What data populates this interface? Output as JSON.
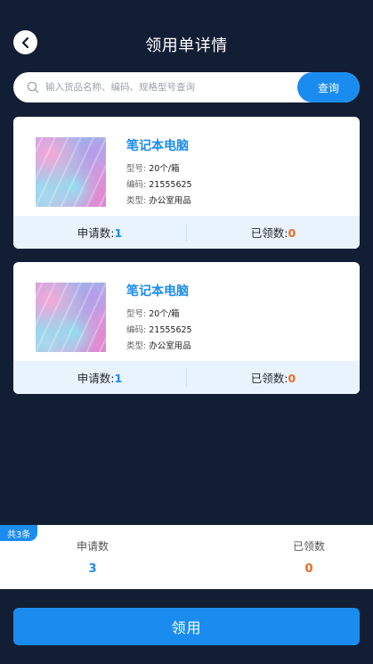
{
  "header": {
    "title": "领用单详情"
  },
  "search": {
    "placeholder": "输入货品名称、编码、规格型号查询",
    "button_label": "查询"
  },
  "items": [
    {
      "name": "笔记本电脑",
      "model_label": "型号:",
      "model": "20个/箱",
      "code_label": "编码:",
      "code": "21555625",
      "type_label": "类型:",
      "type": "办公室用品",
      "applied_label": "申请数:",
      "applied": "1",
      "received_label": "已领数:",
      "received": "0"
    },
    {
      "name": "笔记本电脑",
      "model_label": "型号:",
      "model": "20个/箱",
      "code_label": "编码:",
      "code": "21555625",
      "type_label": "类型:",
      "type": "办公室用品",
      "applied_label": "申请数:",
      "applied": "1",
      "received_label": "已领数:",
      "received": "0"
    }
  ],
  "summary": {
    "total_badge": "共3条",
    "applied_label": "申请数",
    "applied": "3",
    "received_label": "已领数",
    "received": "0"
  },
  "footer": {
    "submit_label": "领用"
  },
  "colors": {
    "accent": "#1a8cf0",
    "orange": "#f06a1e",
    "background": "#121e33"
  },
  "icons": {
    "back": "chevron-left-icon",
    "search": "search-icon"
  }
}
